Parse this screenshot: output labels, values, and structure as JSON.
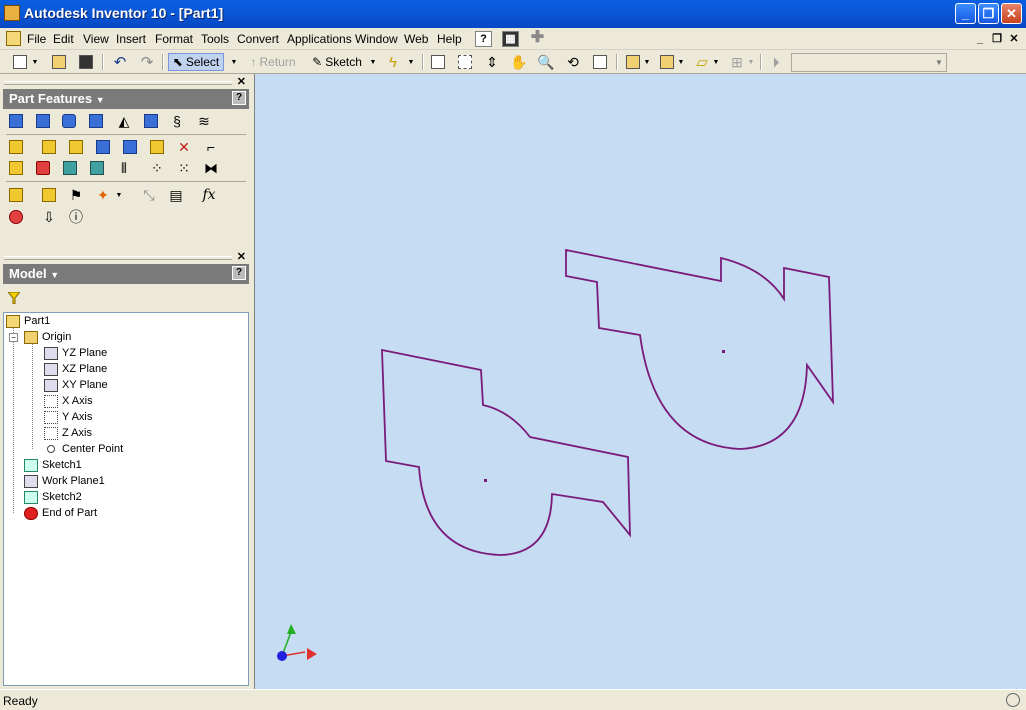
{
  "window": {
    "title": "Autodesk Inventor 10 - [Part1]"
  },
  "menu": {
    "items": [
      "File",
      "Edit",
      "View",
      "Insert",
      "Format",
      "Tools",
      "Convert",
      "Applications",
      "Window",
      "Web",
      "Help"
    ]
  },
  "toolbar": {
    "select_label": "Select",
    "return_label": "Return",
    "sketch_label": "Sketch",
    "combo_value": ""
  },
  "part_features": {
    "title": "Part Features",
    "help": "?"
  },
  "model": {
    "title": "Model",
    "help": "?",
    "tree": [
      {
        "label": "Part1",
        "icon": "part-icon"
      },
      {
        "label": "Origin",
        "icon": "folder-icon"
      },
      {
        "label": "YZ Plane",
        "icon": "plane-icon"
      },
      {
        "label": "XZ Plane",
        "icon": "plane-icon"
      },
      {
        "label": "XY Plane",
        "icon": "plane-icon"
      },
      {
        "label": "X Axis",
        "icon": "axis-icon"
      },
      {
        "label": "Y Axis",
        "icon": "axis-icon"
      },
      {
        "label": "Z Axis",
        "icon": "axis-icon"
      },
      {
        "label": "Center Point",
        "icon": "point-icon"
      },
      {
        "label": "Sketch1",
        "icon": "sketch-icon"
      },
      {
        "label": "Work Plane1",
        "icon": "workplane-icon"
      },
      {
        "label": "Sketch2",
        "icon": "sketch-icon"
      },
      {
        "label": "End of Part",
        "icon": "end-of-part-icon"
      }
    ]
  },
  "status": {
    "text": "Ready"
  },
  "colors": {
    "sketch_line": "#7a1a7a",
    "canvas_bg": "#c5dcf3",
    "title_bar": "#0a5fe0"
  }
}
